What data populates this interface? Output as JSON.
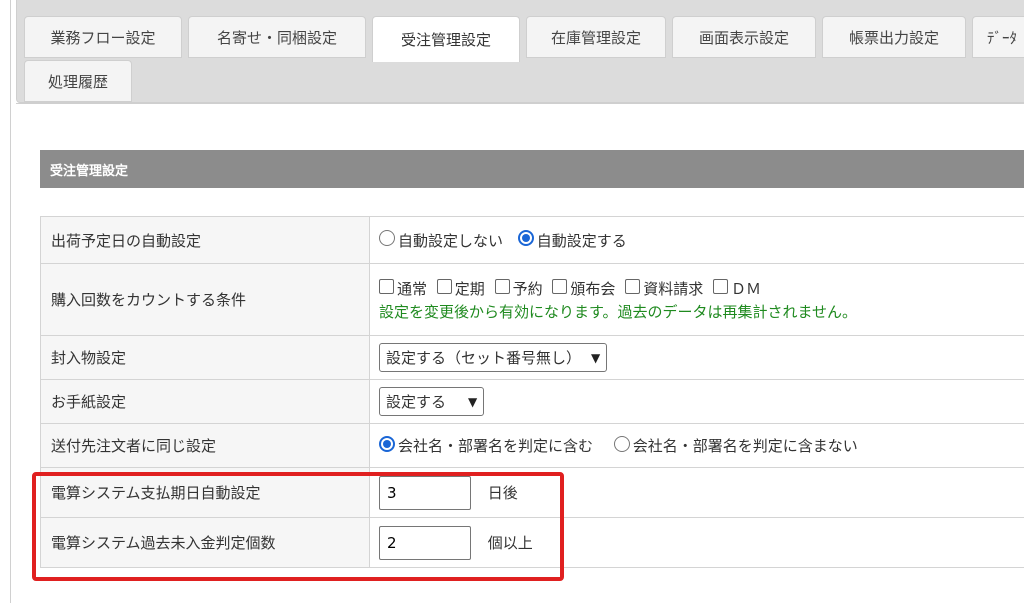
{
  "tabs": [
    {
      "label": "業務フロー設定"
    },
    {
      "label": "名寄せ・同梱設定"
    },
    {
      "label": "受注管理設定"
    },
    {
      "label": "在庫管理設定"
    },
    {
      "label": "画面表示設定"
    },
    {
      "label": "帳票出力設定"
    },
    {
      "label": "ﾃﾞｰﾀ"
    },
    {
      "label": "処理履歴"
    }
  ],
  "section": {
    "title": "受注管理設定"
  },
  "rows": {
    "ship_date": {
      "label": "出荷予定日の自動設定",
      "options": [
        "自動設定しない",
        "自動設定する"
      ],
      "selected": "自動設定する"
    },
    "purchase_count": {
      "label": "購入回数をカウントする条件",
      "options": [
        "通常",
        "定期",
        "予約",
        "頒布会",
        "資料請求",
        "ＤＭ"
      ],
      "note": "設定を変更後から有効になります。過去のデータは再集計されません。"
    },
    "enclosure": {
      "label": "封入物設定",
      "value": "設定する（セット番号無し）"
    },
    "letter": {
      "label": "お手紙設定",
      "value": "設定する"
    },
    "same_as_order": {
      "label": "送付先注文者に同じ設定",
      "options": [
        "会社名・部署名を判定に含む",
        "会社名・部署名を判定に含まない"
      ],
      "selected": "会社名・部署名を判定に含む"
    },
    "densan_payment": {
      "label": "電算システム支払期日自動設定",
      "value": "3",
      "unit": "日後"
    },
    "densan_unpaid": {
      "label": "電算システム過去未入金判定個数",
      "value": "2",
      "unit": "個以上"
    }
  },
  "colors": {
    "accent": "#1a66d6",
    "note": "#1f8a1f",
    "highlight": "#e02020",
    "header": "#8c8c8c"
  }
}
